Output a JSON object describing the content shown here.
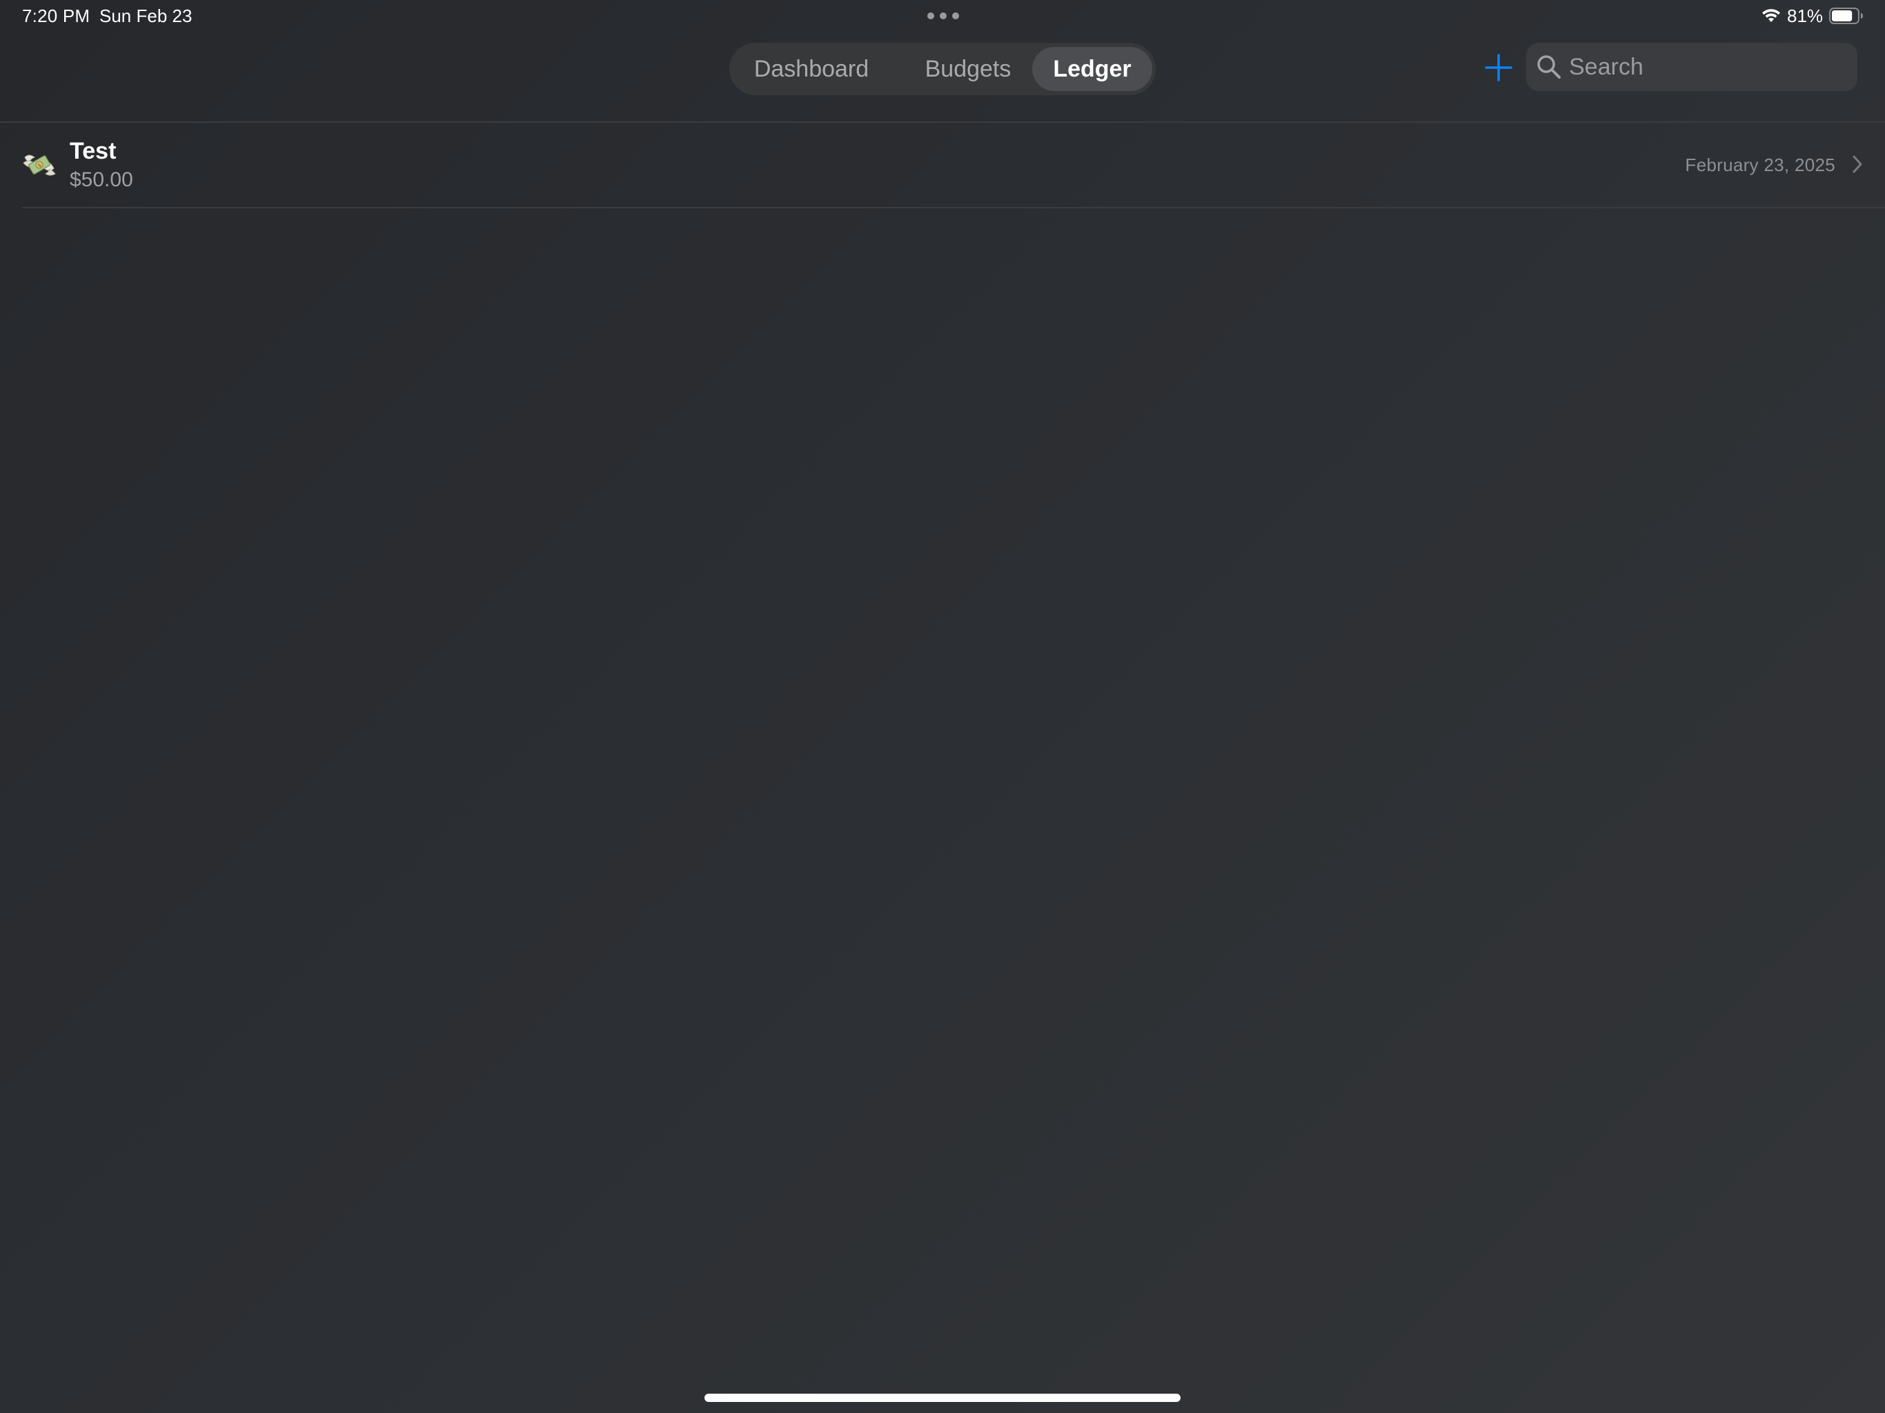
{
  "status_bar": {
    "time": "7:20 PM",
    "date": "Sun Feb 23",
    "battery_percent": "81%",
    "battery_level": 0.81,
    "icons": [
      "wifi-icon",
      "battery-icon"
    ]
  },
  "tabs": [
    {
      "label": "Dashboard",
      "selected": false
    },
    {
      "label": "Budgets",
      "selected": false
    },
    {
      "label": "Ledger",
      "selected": true
    }
  ],
  "toolbar": {
    "add_icon": "plus-icon",
    "search_placeholder": "Search",
    "search_value": ""
  },
  "ledger": {
    "entries": [
      {
        "title": "Test",
        "amount": "$50.00",
        "date": "February 23, 2025",
        "icon": "money-with-wings-icon"
      }
    ]
  },
  "colors": {
    "accent": "#0a84ff",
    "background": "#2c2f33",
    "selected_tab": "#4b4d50"
  }
}
